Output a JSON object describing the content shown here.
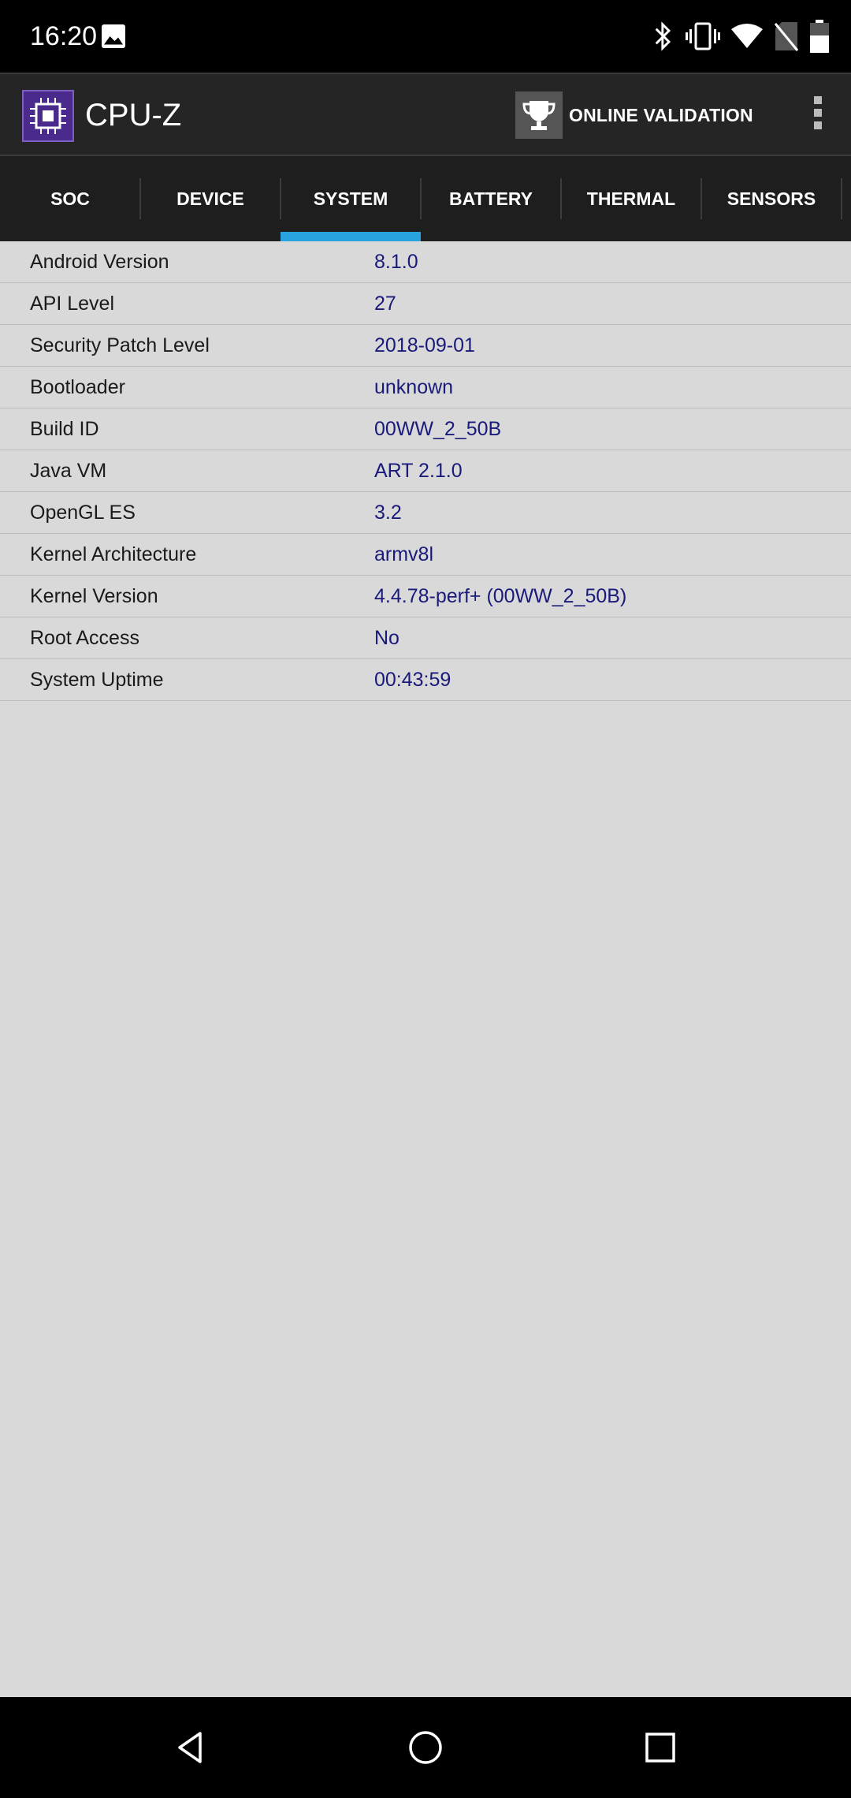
{
  "status_bar": {
    "time": "16:20",
    "icons": [
      "image-icon",
      "bluetooth-icon",
      "vibrate-icon",
      "wifi-icon",
      "no-sim-icon",
      "battery-icon"
    ]
  },
  "app_bar": {
    "title": "CPU-Z",
    "validation_label": "ONLINE VALIDATION",
    "logo_color": "#4a2a8c"
  },
  "tabs": [
    {
      "label": "SOC"
    },
    {
      "label": "DEVICE"
    },
    {
      "label": "SYSTEM"
    },
    {
      "label": "BATTERY"
    },
    {
      "label": "THERMAL"
    },
    {
      "label": "SENSORS"
    }
  ],
  "selected_tab": "SYSTEM",
  "accent_color": "#29a3e0",
  "system_info": [
    {
      "label": "Android Version",
      "value": "8.1.0"
    },
    {
      "label": "API Level",
      "value": "27"
    },
    {
      "label": "Security Patch Level",
      "value": "2018-09-01"
    },
    {
      "label": "Bootloader",
      "value": "unknown"
    },
    {
      "label": "Build ID",
      "value": "00WW_2_50B"
    },
    {
      "label": "Java VM",
      "value": "ART 2.1.0"
    },
    {
      "label": "OpenGL ES",
      "value": "3.2"
    },
    {
      "label": "Kernel Architecture",
      "value": "armv8l"
    },
    {
      "label": "Kernel Version",
      "value": "4.4.78-perf+ (00WW_2_50B)"
    },
    {
      "label": "Root Access",
      "value": "No"
    },
    {
      "label": "System Uptime",
      "value": "00:43:59"
    }
  ],
  "nav_bar": {
    "buttons": [
      "back-icon",
      "home-icon",
      "recents-icon"
    ]
  }
}
